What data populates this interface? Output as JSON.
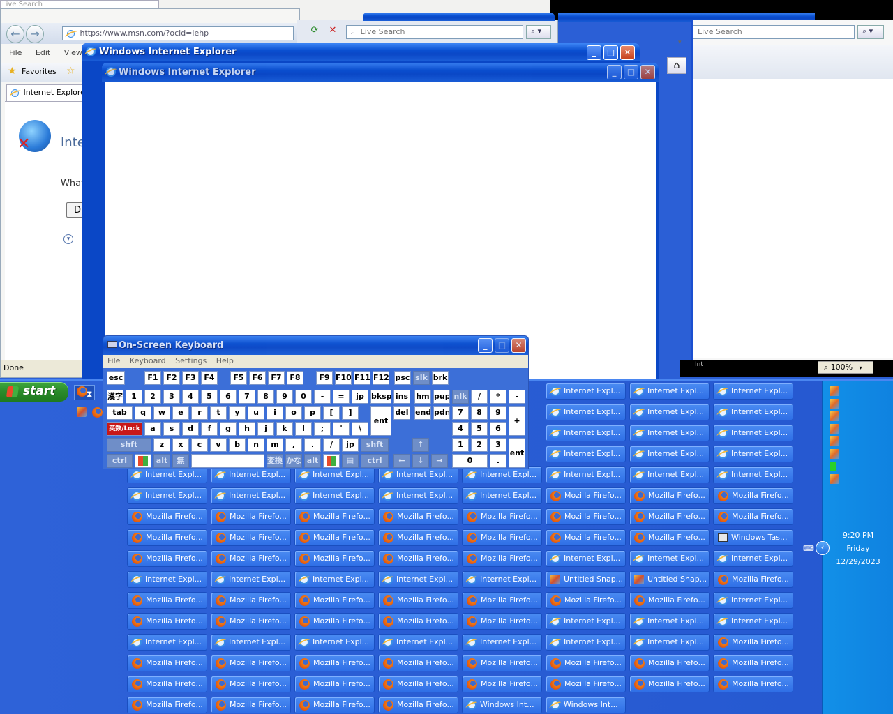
{
  "bg_windows": {
    "top_left_search": "Live Search",
    "address_url": "https://www.msn.com/?ocid=iehp",
    "live_search_placeholder": "Live Search",
    "live_search_placeholder_right": "Live Search",
    "menu": [
      "File",
      "Edit",
      "View"
    ],
    "favorites_label": "Favorites",
    "tab_label": "Internet Explorer",
    "content_heading": "Inte",
    "content_text": "What",
    "content_button": "Di",
    "status_done": "Done",
    "zoom_level": "100%",
    "right_window_partial_text": "Int"
  },
  "ie_window_back": {
    "title": "Windows Internet Explorer"
  },
  "ie_window_front": {
    "title": "Windows Internet Explorer"
  },
  "osk": {
    "title": "On-Screen Keyboard",
    "menu": [
      "File",
      "Keyboard",
      "Settings",
      "Help"
    ],
    "rows": {
      "r1": [
        "esc",
        "F1",
        "F2",
        "F3",
        "F4",
        "F5",
        "F6",
        "F7",
        "F8",
        "F9",
        "F10",
        "F11",
        "F12",
        "psc",
        "slk",
        "brk"
      ],
      "r2": [
        "漢字",
        "1",
        "2",
        "3",
        "4",
        "5",
        "6",
        "7",
        "8",
        "9",
        "0",
        "-",
        "=",
        "jp",
        "bksp",
        "ins",
        "hm",
        "pup",
        "nlk",
        "/",
        "*",
        "-"
      ],
      "r3": [
        "tab",
        "q",
        "w",
        "e",
        "r",
        "t",
        "y",
        "u",
        "i",
        "o",
        "p",
        "[",
        "]",
        "ent",
        "del",
        "end",
        "pdn",
        "7",
        "8",
        "9",
        "+"
      ],
      "r4": [
        "英数/Lock",
        "a",
        "s",
        "d",
        "f",
        "g",
        "h",
        "j",
        "k",
        "l",
        ";",
        "'",
        "\\",
        "4",
        "5",
        "6"
      ],
      "r5": [
        "shft",
        "z",
        "x",
        "c",
        "v",
        "b",
        "n",
        "m",
        ",",
        ".",
        "/",
        "jp",
        "shft",
        "↑",
        "1",
        "2",
        "3",
        "ent"
      ],
      "r6": [
        "ctrl",
        "win",
        "alt",
        "無",
        "space",
        "変換",
        "かな",
        "alt",
        "win",
        "menu",
        "ctrl",
        "←",
        "↓",
        "→",
        "0",
        "."
      ]
    }
  },
  "taskbar": {
    "start_label": "start",
    "clock_time": "9:20 PM",
    "clock_day": "Friday",
    "clock_date": "12/29/2023",
    "buttons": [
      {
        "icon": "ie",
        "label": "Internet Expl..."
      },
      {
        "icon": "ie",
        "label": "Internet Expl..."
      },
      {
        "icon": "ie",
        "label": "Internet Expl..."
      },
      {
        "icon": "ie",
        "label": "Internet Expl..."
      },
      {
        "icon": "ie",
        "label": "Internet Expl..."
      },
      {
        "icon": "ie",
        "label": "Internet Expl..."
      },
      {
        "icon": "ie",
        "label": "Internet Expl..."
      },
      {
        "icon": "ie",
        "label": "Internet Expl..."
      },
      {
        "icon": "ie",
        "label": "Internet Expl..."
      },
      {
        "icon": "ie",
        "label": "Internet Expl..."
      },
      {
        "icon": "ie",
        "label": "Internet Expl..."
      },
      {
        "icon": "ie",
        "label": "Internet Expl..."
      },
      {
        "icon": "ie",
        "label": "Internet Expl..."
      },
      {
        "icon": "ie",
        "label": "Internet Expl..."
      },
      {
        "icon": "ie",
        "label": "Internet Expl..."
      },
      {
        "icon": "ie",
        "label": "Internet Expl..."
      },
      {
        "icon": "ie",
        "label": "Internet Expl..."
      },
      {
        "icon": "ie",
        "label": "Internet Expl..."
      },
      {
        "icon": "ie",
        "label": "Internet Expl..."
      },
      {
        "icon": "ie",
        "label": "Internet Expl..."
      },
      {
        "icon": "ie",
        "label": "Internet Expl..."
      },
      {
        "icon": "ie",
        "label": "Internet Expl..."
      },
      {
        "icon": "ie",
        "label": "Internet Expl..."
      },
      {
        "icon": "ie",
        "label": "Internet Expl..."
      },
      {
        "icon": "ie",
        "label": "Internet Expl..."
      },
      {
        "icon": "ff",
        "label": "Mozilla Firefo..."
      },
      {
        "icon": "ff",
        "label": "Mozilla Firefo..."
      },
      {
        "icon": "ff",
        "label": "Mozilla Firefo..."
      },
      {
        "icon": "ff",
        "label": "Mozilla Firefo..."
      },
      {
        "icon": "ff",
        "label": "Mozilla Firefo..."
      },
      {
        "icon": "ff",
        "label": "Mozilla Firefo..."
      },
      {
        "icon": "ff",
        "label": "Mozilla Firefo..."
      },
      {
        "icon": "ff",
        "label": "Mozilla Firefo..."
      },
      {
        "icon": "ff",
        "label": "Mozilla Firefo..."
      },
      {
        "icon": "ff",
        "label": "Mozilla Firefo..."
      },
      {
        "icon": "ff",
        "label": "Mozilla Firefo..."
      },
      {
        "icon": "ff",
        "label": "Mozilla Firefo..."
      },
      {
        "icon": "ff",
        "label": "Mozilla Firefo..."
      },
      {
        "icon": "ff",
        "label": "Mozilla Firefo..."
      },
      {
        "icon": "ff",
        "label": "Mozilla Firefo..."
      },
      {
        "icon": "ff",
        "label": "Mozilla Firefo..."
      },
      {
        "icon": "ff",
        "label": "Mozilla Firefo..."
      },
      {
        "icon": "ff",
        "label": "Mozilla Firefo..."
      },
      {
        "icon": "tm",
        "label": "Windows Tas..."
      },
      {
        "icon": "ff",
        "label": "Mozilla Firefo..."
      },
      {
        "icon": "ff",
        "label": "Mozilla Firefo..."
      },
      {
        "icon": "ff",
        "label": "Mozilla Firefo..."
      },
      {
        "icon": "ff",
        "label": "Mozilla Firefo..."
      },
      {
        "icon": "ff",
        "label": "Mozilla Firefo..."
      },
      {
        "icon": "ie",
        "label": "Internet Expl..."
      },
      {
        "icon": "ie",
        "label": "Internet Expl..."
      },
      {
        "icon": "ie",
        "label": "Internet Expl..."
      },
      {
        "icon": "ie",
        "label": "Internet Expl..."
      },
      {
        "icon": "ie",
        "label": "Internet Expl..."
      },
      {
        "icon": "ie",
        "label": "Internet Expl..."
      },
      {
        "icon": "ie",
        "label": "Internet Expl..."
      },
      {
        "icon": "ie",
        "label": "Internet Expl..."
      },
      {
        "icon": "snap",
        "label": "Untitled Snap..."
      },
      {
        "icon": "snap",
        "label": "Untitled Snap..."
      },
      {
        "icon": "ff",
        "label": "Mozilla Firefo..."
      },
      {
        "icon": "ff",
        "label": "Mozilla Firefo..."
      },
      {
        "icon": "ff",
        "label": "Mozilla Firefo..."
      },
      {
        "icon": "ff",
        "label": "Mozilla Firefo..."
      },
      {
        "icon": "ff",
        "label": "Mozilla Firefo..."
      },
      {
        "icon": "ff",
        "label": "Mozilla Firefo..."
      },
      {
        "icon": "ff",
        "label": "Mozilla Firefo..."
      },
      {
        "icon": "ff",
        "label": "Mozilla Firefo..."
      },
      {
        "icon": "ie",
        "label": "Internet Expl..."
      },
      {
        "icon": "ff",
        "label": "Mozilla Firefo..."
      },
      {
        "icon": "ff",
        "label": "Mozilla Firefo..."
      },
      {
        "icon": "ff",
        "label": "Mozilla Firefo..."
      },
      {
        "icon": "ff",
        "label": "Mozilla Firefo..."
      },
      {
        "icon": "ff",
        "label": "Mozilla Firefo..."
      },
      {
        "icon": "ie",
        "label": "Internet Expl..."
      },
      {
        "icon": "ie",
        "label": "Internet Expl..."
      },
      {
        "icon": "ie",
        "label": "Internet Expl..."
      },
      {
        "icon": "ie",
        "label": "Internet Expl..."
      },
      {
        "icon": "ie",
        "label": "Internet Expl..."
      },
      {
        "icon": "ie",
        "label": "Internet Expl..."
      },
      {
        "icon": "ie",
        "label": "Internet Expl..."
      },
      {
        "icon": "ie",
        "label": "Internet Expl..."
      },
      {
        "icon": "ie",
        "label": "Internet Expl..."
      },
      {
        "icon": "ie",
        "label": "Internet Expl..."
      },
      {
        "icon": "ff",
        "label": "Mozilla Firefo..."
      },
      {
        "icon": "ff",
        "label": "Mozilla Firefo..."
      },
      {
        "icon": "ff",
        "label": "Mozilla Firefo..."
      },
      {
        "icon": "ff",
        "label": "Mozilla Firefo..."
      },
      {
        "icon": "ff",
        "label": "Mozilla Firefo..."
      },
      {
        "icon": "ff",
        "label": "Mozilla Firefo..."
      },
      {
        "icon": "ff",
        "label": "Mozilla Firefo..."
      },
      {
        "icon": "ff",
        "label": "Mozilla Firefo..."
      },
      {
        "icon": "ff",
        "label": "Mozilla Firefo..."
      },
      {
        "icon": "ff",
        "label": "Mozilla Firefo..."
      },
      {
        "icon": "ff",
        "label": "Mozilla Firefo..."
      },
      {
        "icon": "ff",
        "label": "Mozilla Firefo..."
      },
      {
        "icon": "ff",
        "label": "Mozilla Firefo..."
      },
      {
        "icon": "ff",
        "label": "Mozilla Firefo..."
      },
      {
        "icon": "ff",
        "label": "Mozilla Firefo..."
      },
      {
        "icon": "ff",
        "label": "Mozilla Firefo..."
      },
      {
        "icon": "ff",
        "label": "Mozilla Firefo..."
      },
      {
        "icon": "ff",
        "label": "Mozilla Firefo..."
      },
      {
        "icon": "ff",
        "label": "Mozilla Firefo..."
      },
      {
        "icon": "ff",
        "label": "Mozilla Firefo..."
      },
      {
        "icon": "ff",
        "label": "Mozilla Firefo..."
      },
      {
        "icon": "ie",
        "label": "Windows Int..."
      },
      {
        "icon": "ie",
        "label": "Windows Int..."
      }
    ]
  }
}
